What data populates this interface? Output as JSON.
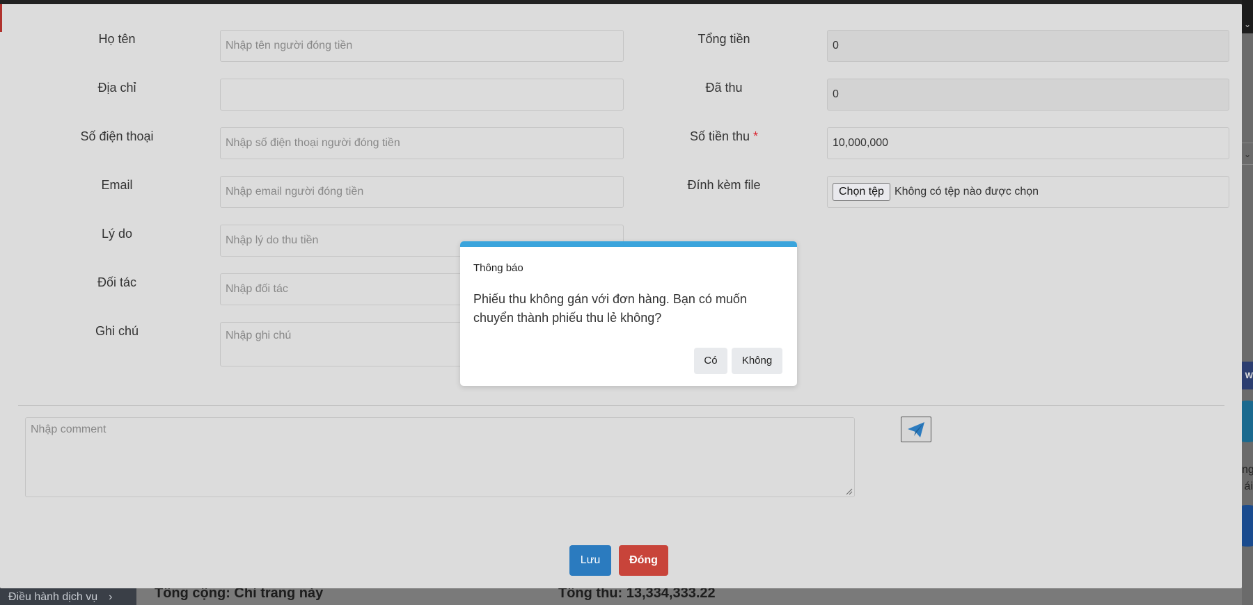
{
  "background": {
    "sidebar_item": "Điều hành dịch vụ",
    "sidebar_chevron": "›",
    "footer_total_label": "Tổng cộng: Chỉ trang này",
    "footer_total_received": "Tổng thu: 13,334,333.22",
    "right_badge": "W",
    "right_text_lines": [
      "ng",
      "ái"
    ]
  },
  "form": {
    "left": [
      {
        "label": "Họ tên",
        "placeholder": "Nhập tên người đóng tiền",
        "value": ""
      },
      {
        "label": "Địa chỉ",
        "placeholder": "",
        "value": ""
      },
      {
        "label": "Số điện thoại",
        "placeholder": "Nhập số điện thoại người đóng tiền",
        "value": ""
      },
      {
        "label": "Email",
        "placeholder": "Nhập email người đóng tiền",
        "value": ""
      },
      {
        "label": "Lý do",
        "placeholder": "Nhập lý do thu tiền",
        "value": ""
      },
      {
        "label": "Đối tác",
        "placeholder": "Nhập đối tác",
        "value": ""
      },
      {
        "label": "Ghi chú",
        "placeholder": "Nhập ghi chú",
        "value": ""
      }
    ],
    "right": {
      "total_label": "Tổng tiền",
      "total_value": "0",
      "collected_label": "Đã thu",
      "collected_value": "0",
      "amount_label": "Số tiền thu",
      "amount_required_mark": "*",
      "amount_value": "10,000,000",
      "attach_label": "Đính kèm file",
      "attach_button": "Chọn tệp",
      "attach_status": "Không có tệp nào được chọn"
    },
    "comment_placeholder": "Nhập comment",
    "send_icon": "paper-plane-icon",
    "save_label": "Lưu",
    "close_label": "Đóng"
  },
  "dialog": {
    "title": "Thông báo",
    "message": "Phiếu thu không gán với đơn hàng. Bạn có muốn chuyển thành phiếu thu lẻ không?",
    "yes_label": "Có",
    "no_label": "Không"
  },
  "colors": {
    "primary": "#2b7bbf",
    "danger": "#c8443a",
    "dialog_accent": "#3aa4dc",
    "required": "#d9232e"
  }
}
